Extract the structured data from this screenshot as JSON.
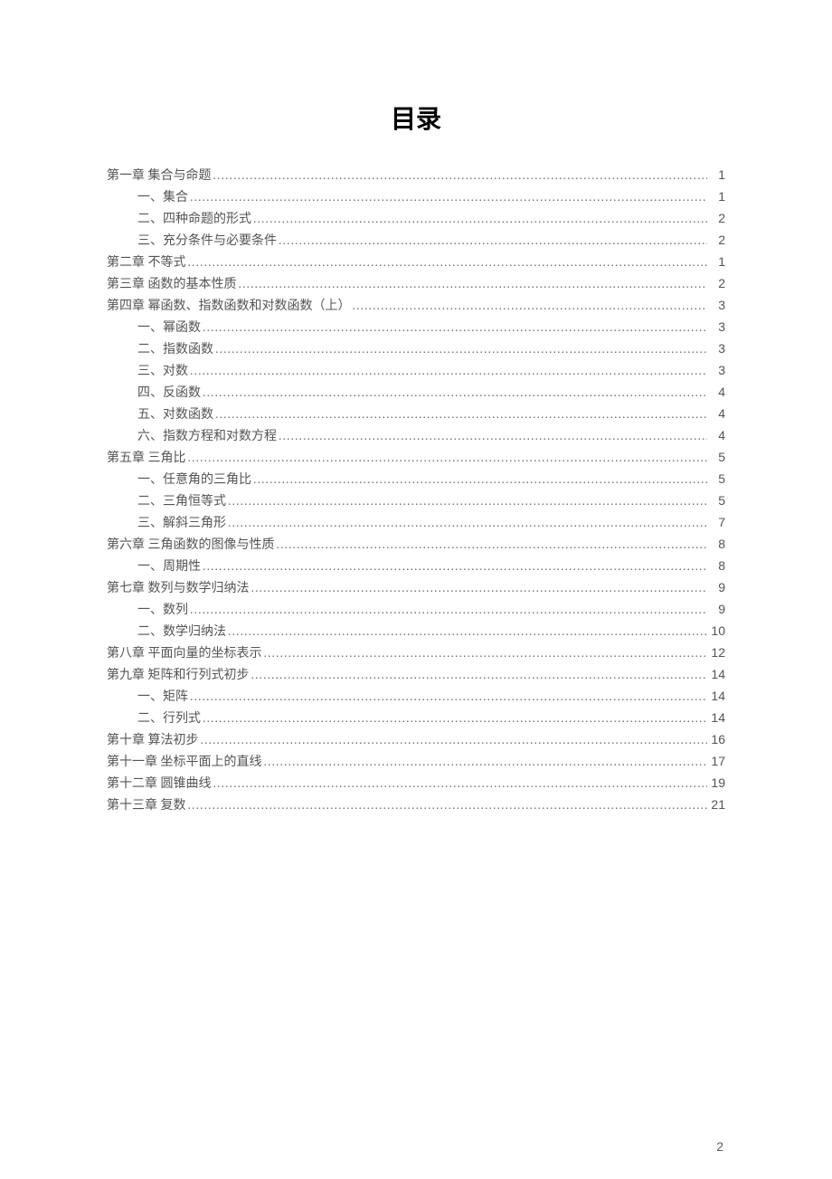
{
  "title": "目录",
  "footer_page": "2",
  "entries": [
    {
      "label": "第一章 集合与命题",
      "page": "1",
      "indent": 0
    },
    {
      "label": "一、集合",
      "page": "1",
      "indent": 1
    },
    {
      "label": "二、四种命题的形式",
      "page": "2",
      "indent": 1
    },
    {
      "label": "三、充分条件与必要条件",
      "page": "2",
      "indent": 1
    },
    {
      "label": "第二章 不等式",
      "page": "1",
      "indent": 0
    },
    {
      "label": "第三章 函数的基本性质",
      "page": "2",
      "indent": 0
    },
    {
      "label": "第四章 幂函数、指数函数和对数函数（上）",
      "page": "3",
      "indent": 0
    },
    {
      "label": "一、幂函数",
      "page": "3",
      "indent": 1
    },
    {
      "label": "二、指数函数",
      "page": "3",
      "indent": 1
    },
    {
      "label": "三、对数",
      "page": "3",
      "indent": 1
    },
    {
      "label": "四、反函数",
      "page": "4",
      "indent": 1
    },
    {
      "label": "五、对数函数",
      "page": "4",
      "indent": 1
    },
    {
      "label": "六、指数方程和对数方程",
      "page": "4",
      "indent": 1
    },
    {
      "label": "第五章 三角比",
      "page": "5",
      "indent": 0
    },
    {
      "label": "一、任意角的三角比",
      "page": "5",
      "indent": 1
    },
    {
      "label": "二、三角恒等式",
      "page": "5",
      "indent": 1
    },
    {
      "label": "三、解斜三角形",
      "page": "7",
      "indent": 1
    },
    {
      "label": "第六章 三角函数的图像与性质",
      "page": "8",
      "indent": 0
    },
    {
      "label": "一、周期性",
      "page": "8",
      "indent": 1
    },
    {
      "label": "第七章 数列与数学归纳法",
      "page": "9",
      "indent": 0
    },
    {
      "label": "一、数列",
      "page": "9",
      "indent": 1
    },
    {
      "label": "二、数学归纳法",
      "page": "10",
      "indent": 1
    },
    {
      "label": "第八章 平面向量的坐标表示",
      "page": "12",
      "indent": 0
    },
    {
      "label": "第九章 矩阵和行列式初步",
      "page": "14",
      "indent": 0
    },
    {
      "label": "一、矩阵",
      "page": "14",
      "indent": 1
    },
    {
      "label": "二、行列式",
      "page": "14",
      "indent": 1
    },
    {
      "label": "第十章 算法初步",
      "page": "16",
      "indent": 0
    },
    {
      "label": "第十一章 坐标平面上的直线",
      "page": "17",
      "indent": 0
    },
    {
      "label": "第十二章 圆锥曲线",
      "page": "19",
      "indent": 0
    },
    {
      "label": "第十三章 复数",
      "page": "21",
      "indent": 0
    }
  ]
}
